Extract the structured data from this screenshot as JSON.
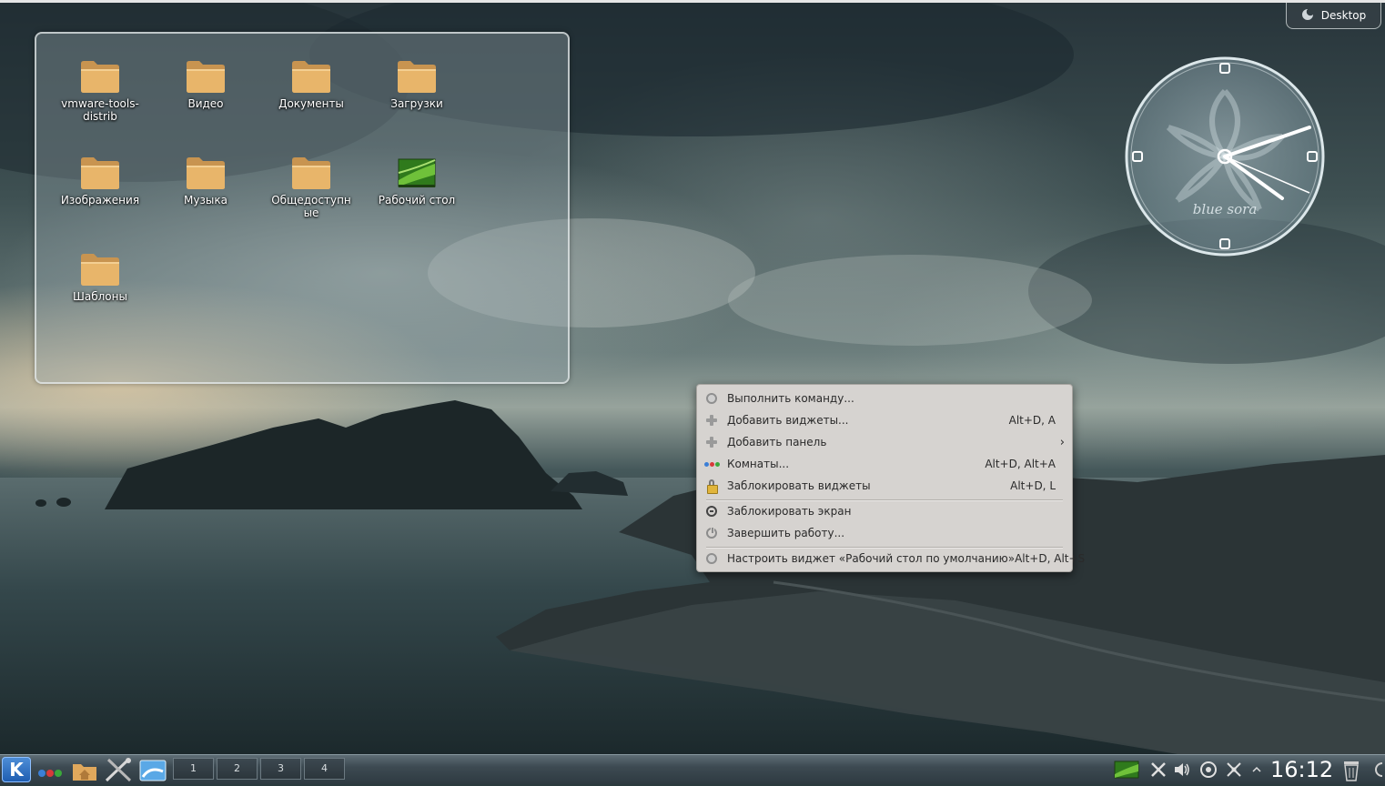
{
  "desktop": {
    "toolbox_label": "Desktop",
    "clock": {
      "hour": 4,
      "minute": 12,
      "label": "blue sora"
    },
    "folder_view": {
      "items": [
        {
          "label": "vmware-tools-distrib",
          "type": "folder"
        },
        {
          "label": "Видео",
          "type": "folder"
        },
        {
          "label": "Документы",
          "type": "folder"
        },
        {
          "label": "Загрузки",
          "type": "folder"
        },
        {
          "label": "Изображения",
          "type": "folder"
        },
        {
          "label": "Музыка",
          "type": "folder"
        },
        {
          "label": "Общедоступные",
          "type": "folder"
        },
        {
          "label": "Рабочий стол",
          "type": "desktop"
        },
        {
          "label": "Шаблоны",
          "type": "folder"
        }
      ]
    }
  },
  "context_menu": {
    "items": [
      {
        "label": "Выполнить команду...",
        "shortcut": "",
        "icon": "run-command-icon"
      },
      {
        "label": "Добавить виджеты...",
        "shortcut": "Alt+D, A",
        "icon": "add-widgets-icon"
      },
      {
        "label": "Добавить панель",
        "shortcut": "",
        "icon": "add-panel-icon",
        "submenu": true
      },
      {
        "label": "Комнаты...",
        "shortcut": "Alt+D, Alt+A",
        "icon": "activities-icon"
      },
      {
        "label": "Заблокировать виджеты",
        "shortcut": "Alt+D, L",
        "icon": "lock-icon"
      },
      {
        "label": "Заблокировать экран",
        "shortcut": "",
        "icon": "lock-screen-icon"
      },
      {
        "label": "Завершить работу...",
        "shortcut": "",
        "icon": "power-icon"
      },
      {
        "label": "Настроить виджет «Рабочий стол по умолчанию»",
        "shortcut": "Alt+D, Alt+S",
        "icon": "configure-icon"
      }
    ],
    "submenu_arrow": "›"
  },
  "panel": {
    "pager": [
      "1",
      "2",
      "3",
      "4"
    ],
    "time": "16:12"
  },
  "colors": {
    "menu_bg": "#d6d3d0",
    "panel_bg": "#3d4a52",
    "folder": "#e8b56a"
  }
}
